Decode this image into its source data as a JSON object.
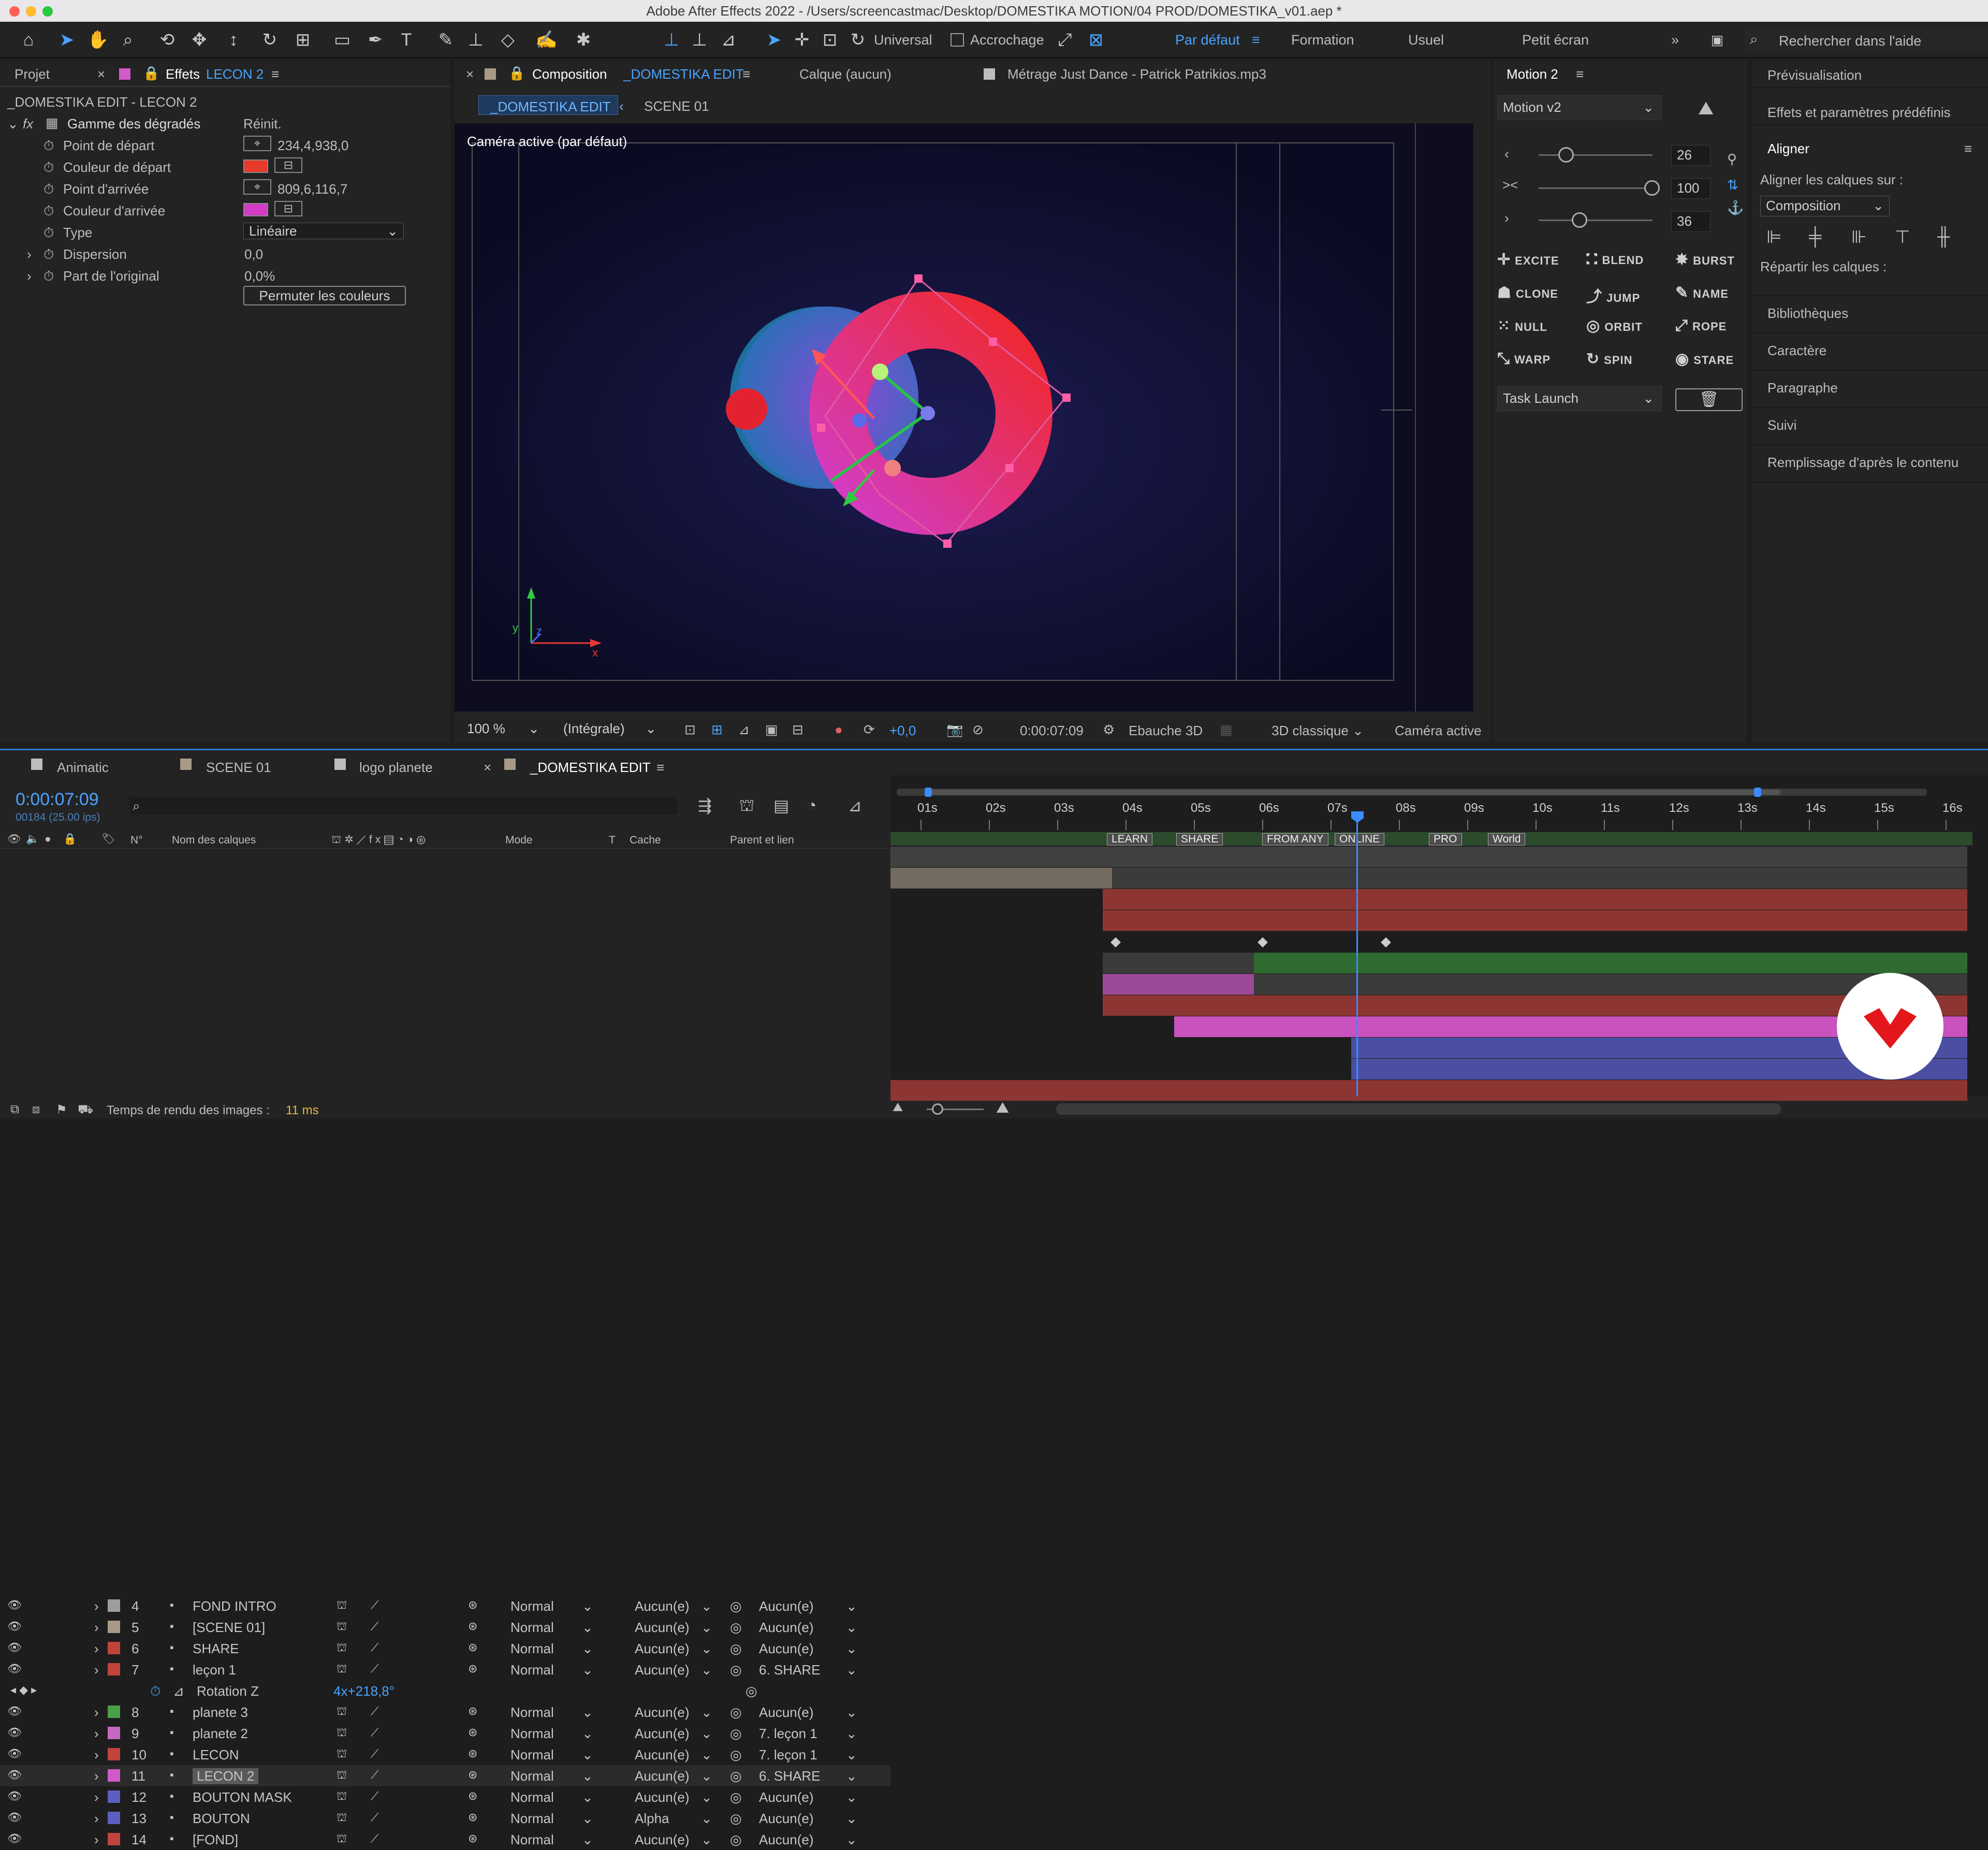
{
  "title": "Adobe After Effects 2022 - /Users/screencastmac/Desktop/DOMESTIKA MOTION/04 PROD/DOMESTIKA_v01.aep *",
  "toolbar": {
    "universal": "Universal",
    "snap": "Accrochage",
    "workspaces": [
      "Par défaut",
      "Formation",
      "Usuel",
      "Petit écran"
    ],
    "search": "Rechercher dans l'aide"
  },
  "left_panel": {
    "tab_project": "Projet",
    "tab_effects": "Effets",
    "tab_effects_layer": "LECON 2",
    "context": "_DOMESTIKA EDIT - LECON 2",
    "effect_name": "Gamme des dégradés",
    "reset": "Réinit.",
    "props": [
      {
        "label": "Point de départ",
        "value": "234,4,938,0"
      },
      {
        "label": "Couleur de départ",
        "value": ""
      },
      {
        "label": "Point d'arrivée",
        "value": "809,6,116,7"
      },
      {
        "label": "Couleur d'arrivée",
        "value": ""
      },
      {
        "label": "Type",
        "value": "Linéaire"
      },
      {
        "label": "Dispersion",
        "value": "0,0"
      },
      {
        "label": "Part de l'original",
        "value": "0,0%"
      }
    ],
    "swap_button": "Permuter les couleurs",
    "start_color": "#e8392a",
    "end_color": "#d23cc6"
  },
  "comp_panel": {
    "tab": "Composition",
    "comp_name": "_DOMESTIKA EDIT",
    "layer_tab": "Calque (aucun)",
    "footage_tab": "Métrage Just Dance - Patrick Patrikios.mp3",
    "crumbs": [
      "_DOMESTIKA EDIT",
      "SCENE 01"
    ],
    "camera_label": "Caméra active (par défaut)",
    "bottom": {
      "zoom": "100 %",
      "resolution": "(Intégrale)",
      "exposure": "+0,0",
      "timecode": "0:00:07:09",
      "draft": "Ebauche 3D",
      "renderer": "3D classique",
      "camera": "Caméra active"
    }
  },
  "motion_panel": {
    "title": "Motion 2",
    "preset": "Motion v2",
    "values": [
      "26",
      "100",
      "36"
    ],
    "buttons": [
      "EXCITE",
      "BLEND",
      "BURST",
      "CLONE",
      "JUMP",
      "NAME",
      "NULL",
      "ORBIT",
      "ROPE",
      "WARP",
      "SPIN",
      "STARE"
    ],
    "task": "Task Launch"
  },
  "right_panel": {
    "items_top": [
      "Prévisualisation",
      "Effets et paramètres prédéfinis"
    ],
    "align_title": "Aligner",
    "align_to_label": "Aligner les calques sur :",
    "align_to": "Composition",
    "distribute": "Répartir les calques :",
    "items_bottom": [
      "Bibliothèques",
      "Caractère",
      "Paragraphe",
      "Suivi",
      "Remplissage d'après le contenu"
    ]
  },
  "timeline": {
    "tabs": [
      "Animatic",
      "SCENE 01",
      "logo planete",
      "_DOMESTIKA EDIT"
    ],
    "timecode": "0:00:07:09",
    "frame_info": "00184 (25.00 ips)",
    "headers": {
      "num": "N°",
      "name": "Nom des calques",
      "mode": "Mode",
      "t": "T",
      "matte": "Cache",
      "parent": "Parent et lien"
    },
    "ruler": [
      "01s",
      "02s",
      "03s",
      "04s",
      "05s",
      "06s",
      "07s",
      "08s",
      "09s",
      "10s",
      "11s",
      "12s",
      "13s",
      "14s",
      "15s",
      "16s"
    ],
    "markers": [
      "LEARN",
      "SHARE",
      "FROM ANY",
      "ONLINE",
      "PRO",
      "World"
    ],
    "layers": [
      {
        "n": "4",
        "name": "FOND INTRO",
        "mode": "Normal",
        "matte": "Aucun(e)",
        "parent": "Aucun(e)",
        "color": "#9e9e9e"
      },
      {
        "n": "5",
        "name": "[SCENE 01]",
        "mode": "Normal",
        "matte": "Aucun(e)",
        "parent": "Aucun(e)",
        "color": "#a89a86"
      },
      {
        "n": "6",
        "name": "SHARE",
        "mode": "Normal",
        "matte": "Aucun(e)",
        "parent": "Aucun(e)",
        "color": "#c0443c"
      },
      {
        "n": "7",
        "name": "leçon 1",
        "mode": "Normal",
        "matte": "Aucun(e)",
        "parent": "6. SHARE",
        "color": "#c0443c"
      },
      {
        "n": "",
        "name": "Rotation Z",
        "mode": "4x+218,8°",
        "matte": "",
        "parent": "",
        "color": ""
      },
      {
        "n": "8",
        "name": "planete 3",
        "mode": "Normal",
        "matte": "Aucun(e)",
        "parent": "Aucun(e)",
        "color": "#49a049"
      },
      {
        "n": "9",
        "name": "planete 2",
        "mode": "Normal",
        "matte": "Aucun(e)",
        "parent": "7. leçon 1",
        "color": "#c46ac0"
      },
      {
        "n": "10",
        "name": "LECON",
        "mode": "Normal",
        "matte": "Aucun(e)",
        "parent": "7. leçon 1",
        "color": "#c0443c"
      },
      {
        "n": "11",
        "name": "LECON 2",
        "mode": "Normal",
        "matte": "Aucun(e)",
        "parent": "6. SHARE",
        "color": "#d25bc9"
      },
      {
        "n": "12",
        "name": "BOUTON MASK",
        "mode": "Normal",
        "matte": "Aucun(e)",
        "parent": "Aucun(e)",
        "color": "#5b5fc0"
      },
      {
        "n": "13",
        "name": "BOUTON",
        "mode": "Normal",
        "matte": "Alpha",
        "parent": "Aucun(e)",
        "color": "#5b5fc0"
      },
      {
        "n": "14",
        "name": "[FOND]",
        "mode": "Normal",
        "matte": "Aucun(e)",
        "parent": "Aucun(e)",
        "color": "#c0443c"
      }
    ],
    "status": "Temps de rendu des images :",
    "render_time": "11 ms"
  }
}
